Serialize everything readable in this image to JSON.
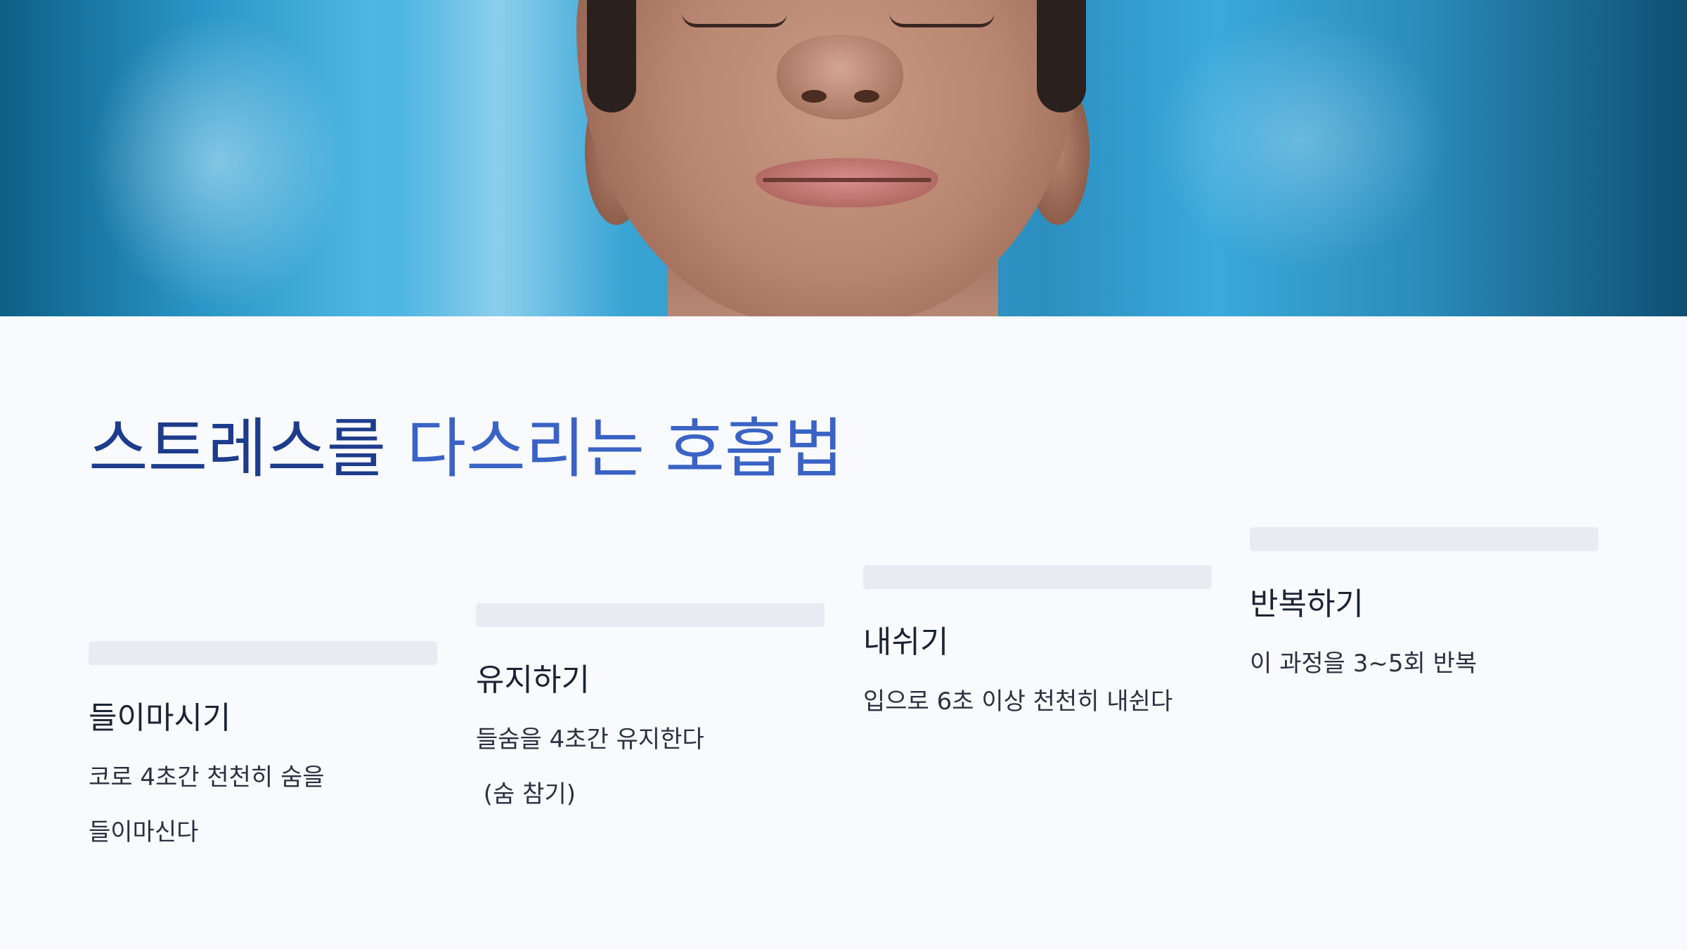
{
  "title": {
    "part1": "스트레스를 ",
    "part2": "다스리는 호흡법"
  },
  "steps": [
    {
      "heading": "들이마시기",
      "desc": [
        "코로 4초간 천천히 숨을",
        "들이마신다"
      ]
    },
    {
      "heading": "유지하기",
      "desc": [
        "들숨을 4초간 유지한다",
        " (숨 참기)"
      ]
    },
    {
      "heading": "내쉬기",
      "desc": [
        "입으로 6초 이상 천천히 내쉰다"
      ]
    },
    {
      "heading": "반복하기",
      "desc": [
        "이 과정을 3~5회 반복"
      ]
    }
  ],
  "colors": {
    "title_dark": "#1e3c8c",
    "title_light": "#3a63c4",
    "bar": "#e8ebf2",
    "background": "#f8fafd"
  },
  "hero_image": "person-breathing-eyes-closed-photo"
}
